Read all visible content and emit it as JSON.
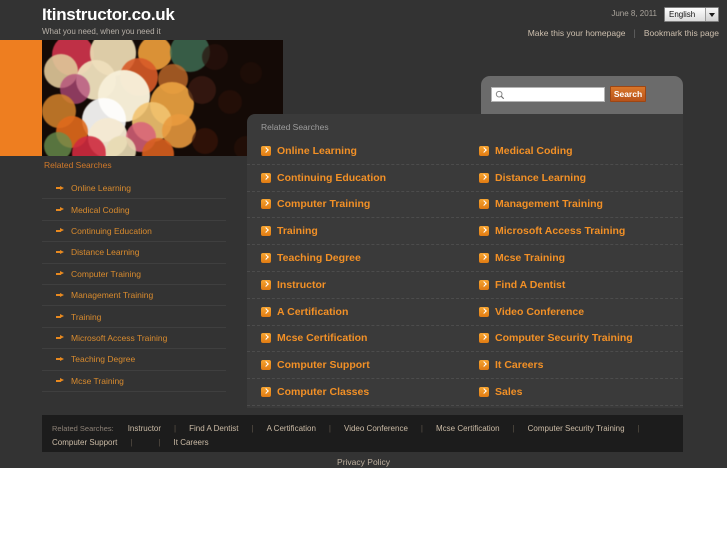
{
  "header": {
    "site_title": "Itinstructor.co.uk",
    "tagline": "What you need, when you need it",
    "date": "June 8, 2011",
    "language": "English",
    "homepage_link": "Make this your homepage",
    "bookmark_link": "Bookmark this page",
    "separator": "|"
  },
  "search": {
    "placeholder": "",
    "value": "",
    "button_label": "Search"
  },
  "panel": {
    "title": "Related Searches",
    "results": [
      [
        "Online Learning",
        "Medical Coding"
      ],
      [
        "Continuing Education",
        "Distance Learning"
      ],
      [
        "Computer Training",
        "Management Training"
      ],
      [
        "Training",
        "Microsoft Access Training"
      ],
      [
        "Teaching Degree",
        "Mcse Training"
      ],
      [
        "Instructor",
        "Find A Dentist"
      ],
      [
        "A Certification",
        "Video Conference"
      ],
      [
        "Mcse Certification",
        "Computer Security Training"
      ],
      [
        "Computer Support",
        "It Careers"
      ],
      [
        "Computer Classes",
        "Sales"
      ]
    ]
  },
  "sidebar": {
    "title": "Related Searches",
    "items": [
      "Online Learning",
      "Medical Coding",
      "Continuing Education",
      "Distance Learning",
      "Computer Training",
      "Management Training",
      "Training",
      "Microsoft Access Training",
      "Teaching Degree",
      "Mcse Training"
    ]
  },
  "footer": {
    "label": "Related Searches:",
    "links": [
      "Instructor",
      "Find A Dentist",
      "A Certification",
      "Video Conference",
      "Mcse Certification",
      "Computer Security Training",
      "Computer Support",
      "It Careers"
    ],
    "separator": "|",
    "privacy": "Privacy Policy"
  },
  "colors": {
    "accent_orange": "#ee7e20",
    "link_orange": "#f29026",
    "page_bg": "#333333",
    "panel_bg": "#3a3a3a",
    "footer_bg": "#1c1c1c"
  }
}
